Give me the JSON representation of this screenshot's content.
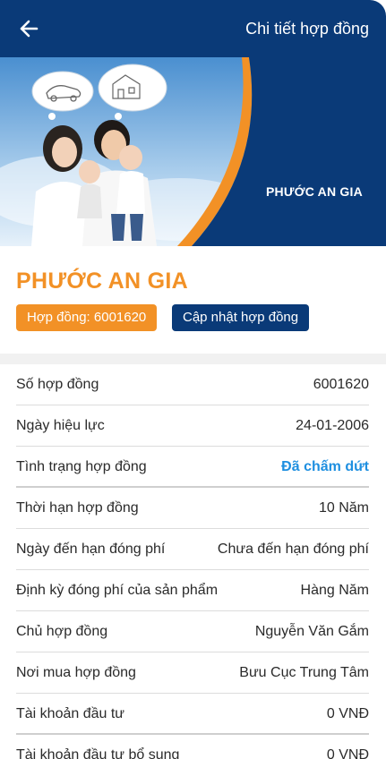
{
  "header": {
    "title": "Chi tiết hợp đồng",
    "back_icon": "arrow-left-icon"
  },
  "banner": {
    "label": "PHƯỚC AN GIA"
  },
  "product": {
    "name": "PHƯỚC AN GIA",
    "contract_badge": "Hợp đồng: 6001620",
    "update_button": "Cập nhật hợp đồng"
  },
  "details": [
    {
      "label": "Số hợp đồng",
      "value": "6001620"
    },
    {
      "label": "Ngày hiệu lực",
      "value": "24-01-2006"
    },
    {
      "label": "Tình trạng hợp đồng",
      "value": "Đã chấm dứt"
    },
    {
      "label": "Thời hạn hợp đồng",
      "value": "10 Năm"
    },
    {
      "label": "Ngày đến hạn đóng phí",
      "value": "Chưa đến hạn đóng phí"
    },
    {
      "label": "Định kỳ đóng phí của sản phẩm",
      "value": "Hàng Năm"
    },
    {
      "label": "Chủ hợp đồng",
      "value": "Nguyễn Văn Gắm"
    },
    {
      "label": "Nơi mua hợp đồng",
      "value": "Bưu Cục Trung Tâm"
    },
    {
      "label": "Tài khoản đầu tư",
      "value": "0 VNĐ"
    },
    {
      "label": "Tài khoản đầu tư bổ sung",
      "value": "0 VNĐ"
    }
  ],
  "colors": {
    "primary": "#0a3a78",
    "accent": "#f29126",
    "status": "#1e8fe0"
  }
}
